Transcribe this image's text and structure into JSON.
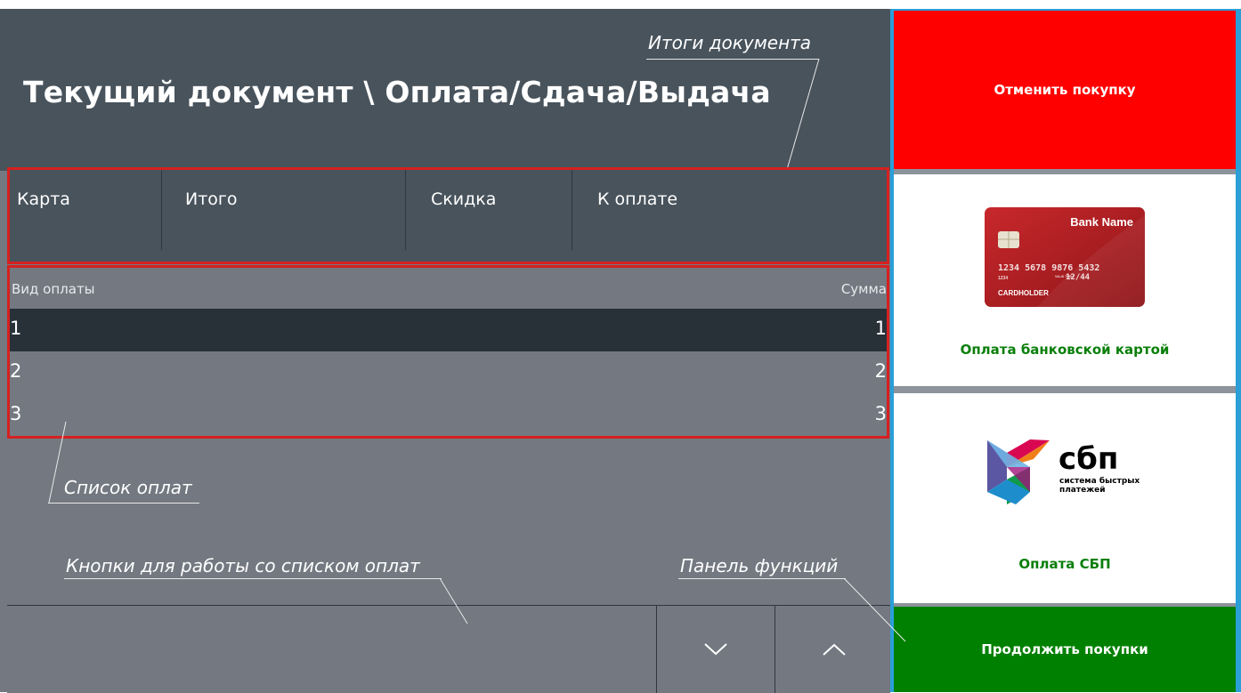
{
  "header": {
    "title": "Текущий документ \\ Оплата/Сдача/Выдача"
  },
  "totals": {
    "card": "Карта",
    "total": "Итого",
    "discount": "Скидка",
    "to_pay": "К оплате"
  },
  "payments": {
    "col_type": "Вид оплаты",
    "col_sum": "Сумма",
    "rows": [
      {
        "num": "1",
        "sum": "1",
        "selected": true
      },
      {
        "num": "2",
        "sum": "2",
        "selected": false
      },
      {
        "num": "3",
        "sum": "3",
        "selected": false
      }
    ]
  },
  "annotations": {
    "totals": "Итоги документа",
    "payment_list": "Список оплат",
    "list_buttons": "Кнопки для работы со списком оплат",
    "function_panel": "Панель функций"
  },
  "functions": {
    "cancel": "Отменить покупку",
    "card_payment": "Оплата банковской картой",
    "sbp_payment": "Оплата СБП",
    "continue": "Продолжить покупки"
  },
  "card_image": {
    "bank_name": "Bank Name",
    "number": "1234  5678  9876  5432",
    "small_number": "1234",
    "valid_label": "VALID THRU",
    "expiry": "12/44",
    "holder": "CARDHOLDER"
  },
  "sbp_logo": {
    "name": "сбп",
    "tagline_1": "система быстрых",
    "tagline_2": "платежей"
  },
  "colors": {
    "header_bg": "#48535c",
    "panel_bg": "#737881",
    "selected_row": "#283038",
    "highlight_border": "#d62020",
    "cancel": "#ff0000",
    "continue": "#008000",
    "label_green": "#0a7f0a",
    "panel_border": "#2a9fd8"
  }
}
